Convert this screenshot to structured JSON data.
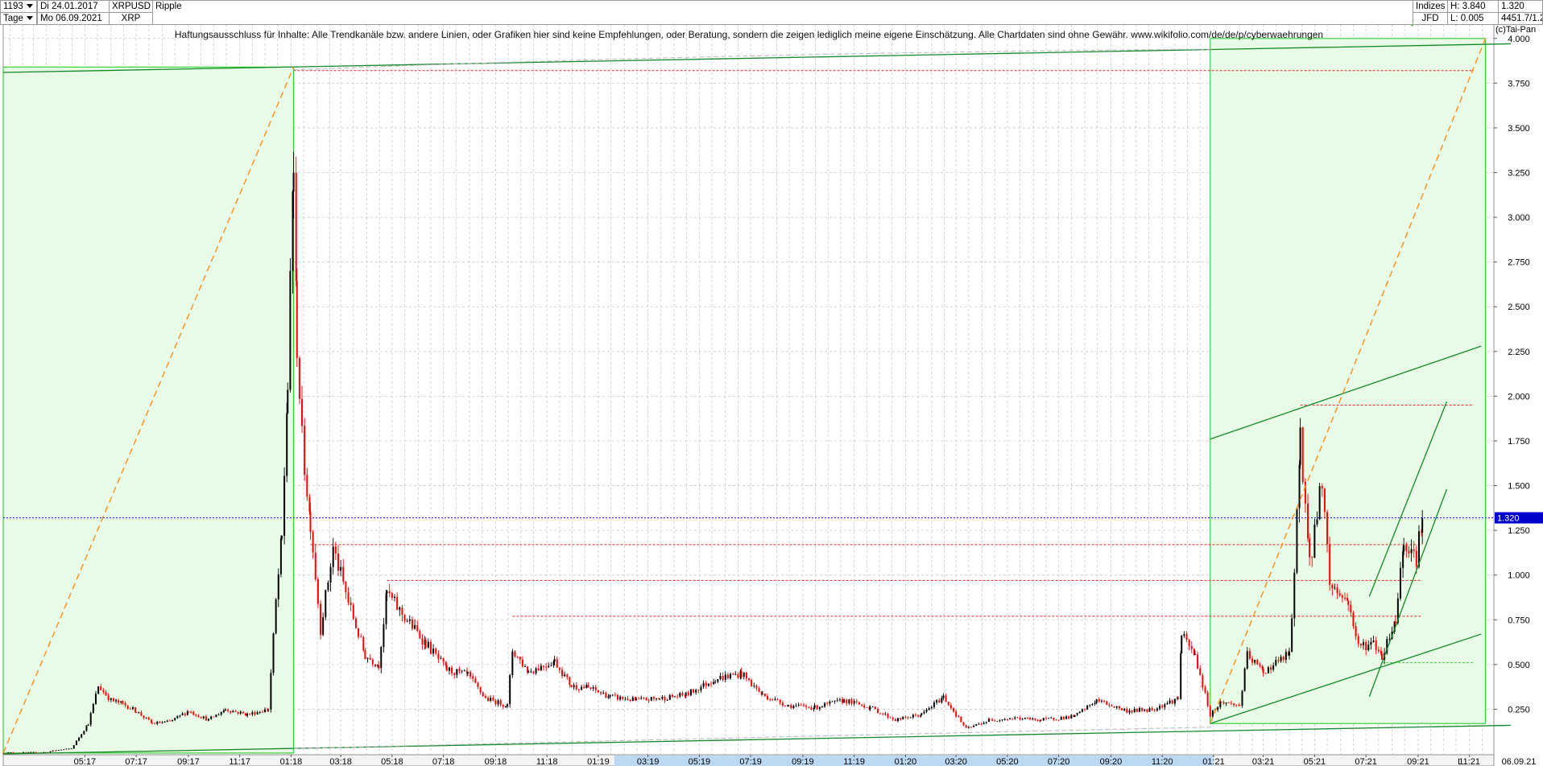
{
  "header": {
    "count": "1193",
    "period": "Tage",
    "date_from": "Di 24.01.2017",
    "date_to": "Mo 06.09.2021",
    "symbol": "XRPUSD",
    "symbol_short": "XRP",
    "name": "Ripple",
    "indizes_label": "Indizes",
    "source": "JFD",
    "high": "H: 3.840",
    "low": "L: 0.005",
    "last": "1.320",
    "right_info": "4451.7/1.2",
    "copyright": "(c)Tai-Pan",
    "current_price_label": "1.320",
    "bottom_date": "06.09.21",
    "log_toggle": "L",
    "disclaimer": "Haftungsausschluss für Inhalte: Alle Trendkanäle bzw. andere Linien, oder Grafiken hier sind keine Empfehlungen, oder Beratung, sondern die zeigen lediglich meine eigene Einschätzung. Alle Chartdaten sind ohne Gewähr.  www.wikifolio.com/de/de/p/cyberwaehrungen"
  },
  "colors": {
    "candle_up": "#000000",
    "candle_down": "#ff0000",
    "box_fill": "#e8fbe6",
    "box_stroke": "#37d237",
    "trend_line": "#14892a",
    "projection": "#ff8c1a",
    "level_line": "#e22a2a",
    "current_price_line": "#2a2ad8",
    "current_price_badge": "#0000cc",
    "grid": "#c8c8c8",
    "highlight_axis": "#bcd9f3"
  },
  "chart_data": {
    "type": "candlestick",
    "title": "Ripple",
    "symbol": "XRPUSD",
    "timeframe": "Tage",
    "y_ticks": [
      0.25,
      0.5,
      0.75,
      1.0,
      1.25,
      1.5,
      1.75,
      2.0,
      2.25,
      2.5,
      2.75,
      3.0,
      3.25,
      3.5,
      3.75,
      4.0
    ],
    "y_tick_labels": [
      "0.250",
      "0.500",
      "0.750",
      "1.000",
      "1.250",
      "1.500",
      "1.750",
      "2.000",
      "2.250",
      "2.500",
      "2.750",
      "3.000",
      "3.250",
      "3.500",
      "3.750",
      "4.000"
    ],
    "ylim": [
      0.0,
      4.08
    ],
    "x_tick_labels": [
      "05:17",
      "07:17",
      "09:17",
      "11:17",
      "01:18",
      "03:18",
      "05:18",
      "07:18",
      "09:18",
      "11:18",
      "01:19",
      "03:19",
      "05:19",
      "07:19",
      "09:19",
      "11:19",
      "01:20",
      "03:20",
      "05:20",
      "07:20",
      "09:20",
      "11:20",
      "01:21",
      "03:21",
      "05:21",
      "07:21",
      "09:21",
      "11:21"
    ],
    "x_start": "2017-01-24",
    "x_end": "2021-11-30",
    "last_date": "2021-09-06",
    "current_price": 1.32,
    "high": 3.84,
    "low": 0.005,
    "series": [
      {
        "name": "XRPUSD",
        "points": [
          [
            "2017-01-24",
            0.006
          ],
          [
            "2017-02-20",
            0.007
          ],
          [
            "2017-03-15",
            0.009
          ],
          [
            "2017-03-28",
            0.02
          ],
          [
            "2017-04-15",
            0.03
          ],
          [
            "2017-05-05",
            0.17
          ],
          [
            "2017-05-17",
            0.38
          ],
          [
            "2017-06-01",
            0.3
          ],
          [
            "2017-06-15",
            0.28
          ],
          [
            "2017-07-01",
            0.24
          ],
          [
            "2017-07-20",
            0.17
          ],
          [
            "2017-08-10",
            0.18
          ],
          [
            "2017-09-01",
            0.24
          ],
          [
            "2017-09-25",
            0.19
          ],
          [
            "2017-10-15",
            0.25
          ],
          [
            "2017-11-10",
            0.22
          ],
          [
            "2017-12-05",
            0.25
          ],
          [
            "2017-12-14",
            0.85
          ],
          [
            "2017-12-21",
            1.2
          ],
          [
            "2017-12-28",
            2.05
          ],
          [
            "2018-01-04",
            3.3
          ],
          [
            "2018-01-08",
            2.3
          ],
          [
            "2018-01-14",
            1.75
          ],
          [
            "2018-01-24",
            1.3
          ],
          [
            "2018-02-05",
            0.7
          ],
          [
            "2018-02-20",
            1.15
          ],
          [
            "2018-03-10",
            0.85
          ],
          [
            "2018-03-30",
            0.55
          ],
          [
            "2018-04-15",
            0.5
          ],
          [
            "2018-04-25",
            0.9
          ],
          [
            "2018-05-10",
            0.8
          ],
          [
            "2018-06-10",
            0.62
          ],
          [
            "2018-07-05",
            0.47
          ],
          [
            "2018-07-30",
            0.44
          ],
          [
            "2018-08-20",
            0.31
          ],
          [
            "2018-09-15",
            0.27
          ],
          [
            "2018-09-21",
            0.58
          ],
          [
            "2018-10-10",
            0.46
          ],
          [
            "2018-11-10",
            0.52
          ],
          [
            "2018-11-30",
            0.38
          ],
          [
            "2018-12-20",
            0.37
          ],
          [
            "2019-01-15",
            0.32
          ],
          [
            "2019-02-15",
            0.3
          ],
          [
            "2019-03-15",
            0.31
          ],
          [
            "2019-04-15",
            0.33
          ],
          [
            "2019-05-20",
            0.42
          ],
          [
            "2019-06-20",
            0.45
          ],
          [
            "2019-07-15",
            0.33
          ],
          [
            "2019-08-15",
            0.27
          ],
          [
            "2019-09-15",
            0.26
          ],
          [
            "2019-10-20",
            0.3
          ],
          [
            "2019-11-20",
            0.26
          ],
          [
            "2019-12-20",
            0.19
          ],
          [
            "2020-01-20",
            0.22
          ],
          [
            "2020-02-15",
            0.32
          ],
          [
            "2020-03-13",
            0.14
          ],
          [
            "2020-04-10",
            0.19
          ],
          [
            "2020-05-10",
            0.2
          ],
          [
            "2020-06-10",
            0.19
          ],
          [
            "2020-07-20",
            0.21
          ],
          [
            "2020-08-15",
            0.3
          ],
          [
            "2020-09-20",
            0.24
          ],
          [
            "2020-10-20",
            0.25
          ],
          [
            "2020-11-20",
            0.31
          ],
          [
            "2020-11-24",
            0.66
          ],
          [
            "2020-12-10",
            0.55
          ],
          [
            "2020-12-28",
            0.22
          ],
          [
            "2021-01-10",
            0.29
          ],
          [
            "2021-02-01",
            0.27
          ],
          [
            "2021-02-10",
            0.55
          ],
          [
            "2021-03-01",
            0.46
          ],
          [
            "2021-04-01",
            0.56
          ],
          [
            "2021-04-07",
            0.97
          ],
          [
            "2021-04-14",
            1.8
          ],
          [
            "2021-04-25",
            1.05
          ],
          [
            "2021-05-10",
            1.55
          ],
          [
            "2021-05-19",
            0.95
          ],
          [
            "2021-06-10",
            0.85
          ],
          [
            "2021-06-22",
            0.6
          ],
          [
            "2021-07-10",
            0.62
          ],
          [
            "2021-07-20",
            0.55
          ],
          [
            "2021-08-05",
            0.75
          ],
          [
            "2021-08-15",
            1.2
          ],
          [
            "2021-08-30",
            1.1
          ],
          [
            "2021-09-06",
            1.32
          ]
        ]
      }
    ],
    "boxes": [
      {
        "x_from": "2017-01-24",
        "x_to": "2018-01-04",
        "y_from": 0.005,
        "y_to": 3.84
      },
      {
        "x_from": "2020-12-28",
        "x_to": "2021-11-20",
        "y_from": 0.17,
        "y_to": 4.0
      }
    ],
    "trend_lines": [
      {
        "from": [
          "2017-01-24",
          3.81
        ],
        "to": [
          "2021-12-20",
          3.97
        ]
      },
      {
        "from": [
          "2017-01-24",
          0.0
        ],
        "to": [
          "2021-12-20",
          0.16
        ]
      },
      {
        "from": [
          "2020-12-28",
          1.76
        ],
        "to": [
          "2021-11-15",
          2.28
        ]
      },
      {
        "from": [
          "2020-12-28",
          0.17
        ],
        "to": [
          "2021-11-15",
          0.67
        ]
      },
      {
        "from": [
          "2021-07-05",
          0.88
        ],
        "to": [
          "2021-10-05",
          1.97
        ]
      },
      {
        "from": [
          "2021-07-05",
          0.32
        ],
        "to": [
          "2021-10-05",
          1.48
        ]
      }
    ],
    "projections": [
      {
        "from": [
          "2017-01-24",
          0.005
        ],
        "to": [
          "2018-01-04",
          3.84
        ]
      },
      {
        "from": [
          "2020-12-28",
          0.17
        ],
        "to": [
          "2021-11-20",
          4.0
        ]
      }
    ],
    "levels": [
      {
        "value": 3.82,
        "x_from": "2018-01-04",
        "x_to": "2021-12-20"
      },
      {
        "value": 1.95,
        "x_from": "2021-04-14",
        "x_to": "2021-12-20"
      },
      {
        "value": 1.17,
        "x_from": "2018-01-24",
        "x_to": "2021-09-06"
      },
      {
        "value": 0.97,
        "x_from": "2018-04-25",
        "x_to": "2021-09-06"
      },
      {
        "value": 0.77,
        "x_from": "2018-09-21",
        "x_to": "2021-09-06"
      },
      {
        "value": 0.51,
        "x_from": "2021-07-20",
        "x_to": "2021-12-20",
        "dotted_green": true
      }
    ]
  }
}
